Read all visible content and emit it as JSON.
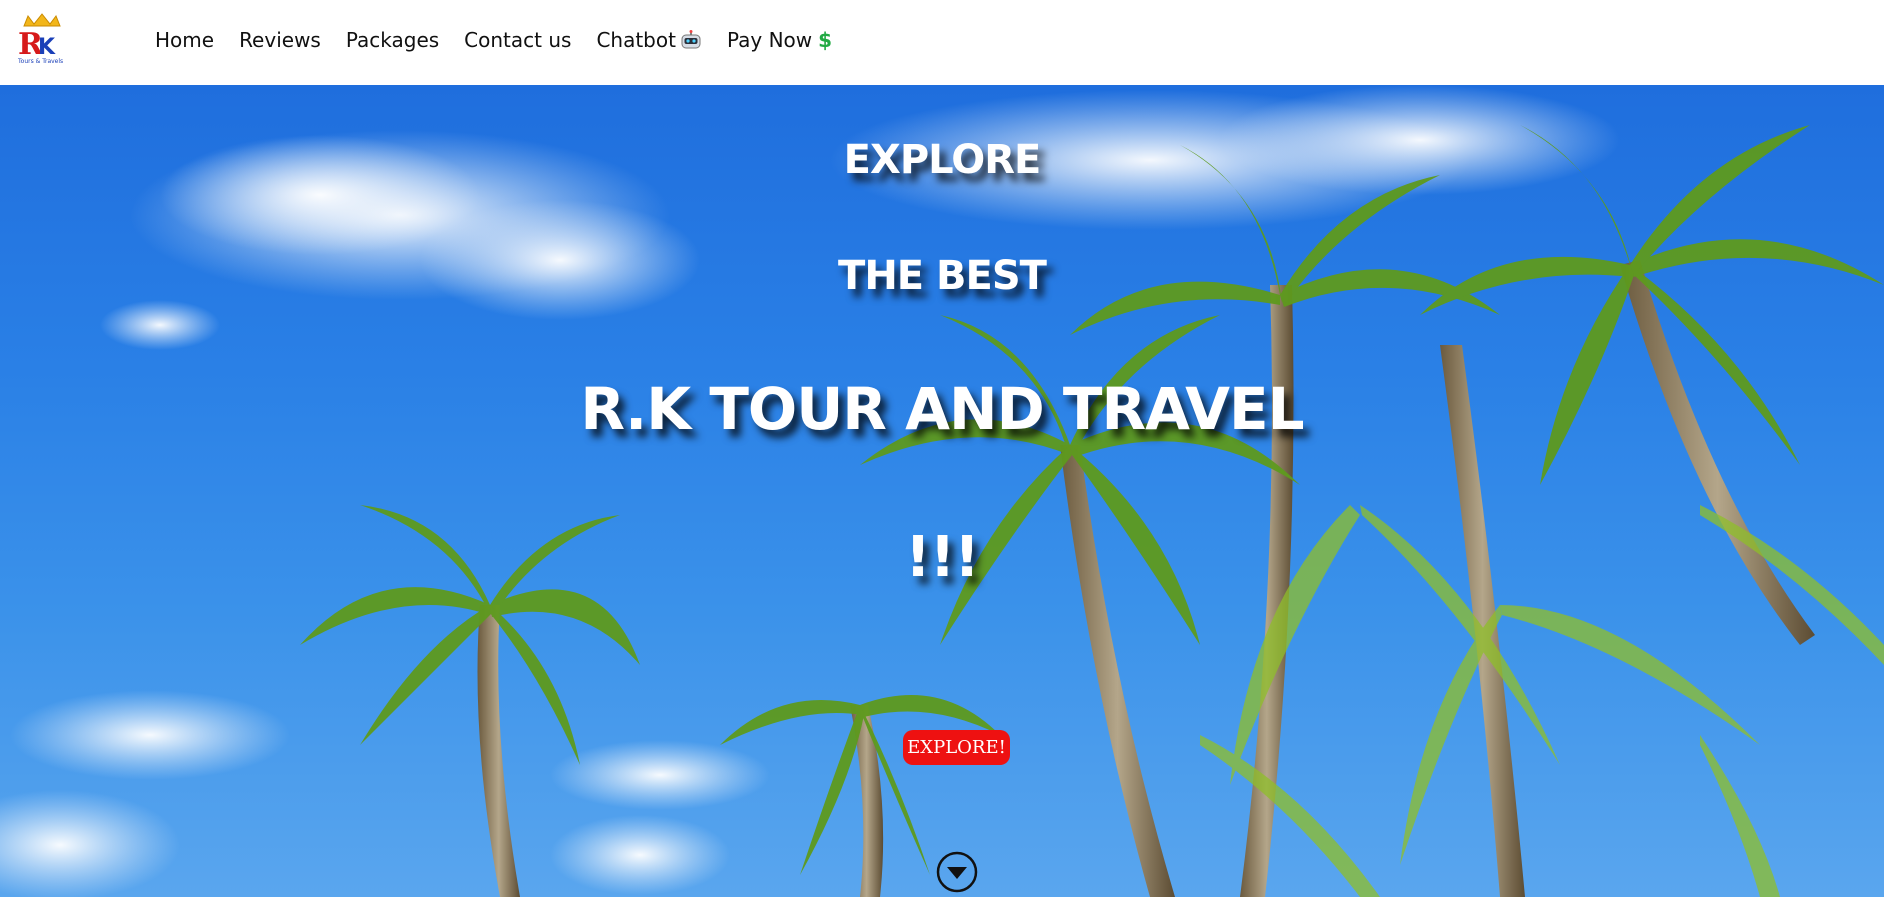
{
  "header": {
    "logo_icon": "rk-tours-travels-logo",
    "logo_text": "Tours & Travels",
    "nav": [
      {
        "label": "Home"
      },
      {
        "label": "Reviews"
      },
      {
        "label": "Packages"
      },
      {
        "label": "Contact us"
      },
      {
        "label": "Chatbot",
        "icon": "robot-icon"
      },
      {
        "label": "Pay Now",
        "icon": "dollar-icon"
      }
    ]
  },
  "hero": {
    "line1": "EXPLORE",
    "line2": "THE BEST",
    "line3": "R.K TOUR AND TRAVEL",
    "line4": "!!!",
    "button_label": "EXPLORE!",
    "scroll_icon": "chevron-down-circle-icon"
  },
  "colors": {
    "button": "#ee1111",
    "dollar": "#22aa44",
    "sky": "#2a80e6"
  }
}
